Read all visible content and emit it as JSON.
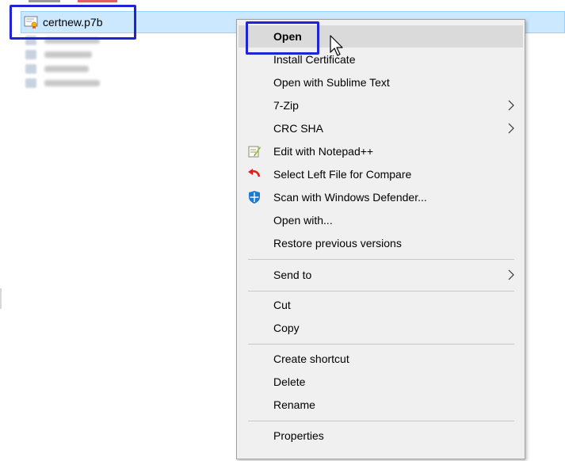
{
  "file": {
    "name": "certnew.p7b",
    "icon": "certificate-file-icon"
  },
  "context_menu": {
    "items": [
      {
        "label": "Open",
        "bold": true,
        "icon": "",
        "submenu": false
      },
      {
        "label": "Install Certificate",
        "icon": "",
        "submenu": false
      },
      {
        "label": "Open with Sublime Text",
        "icon": "",
        "submenu": false
      },
      {
        "label": "7-Zip",
        "icon": "",
        "submenu": true
      },
      {
        "label": "CRC SHA",
        "icon": "",
        "submenu": true
      },
      {
        "label": "Edit with Notepad++",
        "icon": "notepad-plus-plus-icon",
        "submenu": false
      },
      {
        "label": "Select Left File for Compare",
        "icon": "compare-arrow-icon",
        "submenu": false
      },
      {
        "label": "Scan with Windows Defender...",
        "icon": "windows-defender-icon",
        "submenu": false
      },
      {
        "label": "Open with...",
        "icon": "",
        "submenu": false
      },
      {
        "label": "Restore previous versions",
        "icon": "",
        "submenu": false
      },
      {
        "label": "Send to",
        "icon": "",
        "submenu": true
      },
      {
        "label": "Cut",
        "icon": "",
        "submenu": false
      },
      {
        "label": "Copy",
        "icon": "",
        "submenu": false
      },
      {
        "label": "Create shortcut",
        "icon": "",
        "submenu": false
      },
      {
        "label": "Delete",
        "icon": "",
        "submenu": false
      },
      {
        "label": "Rename",
        "icon": "",
        "submenu": false
      },
      {
        "label": "Properties",
        "icon": "",
        "submenu": false
      }
    ]
  },
  "colors": {
    "selection": "#cce8ff",
    "highlight_box": "#1f24d6",
    "menu_background": "#f0f0f0"
  }
}
